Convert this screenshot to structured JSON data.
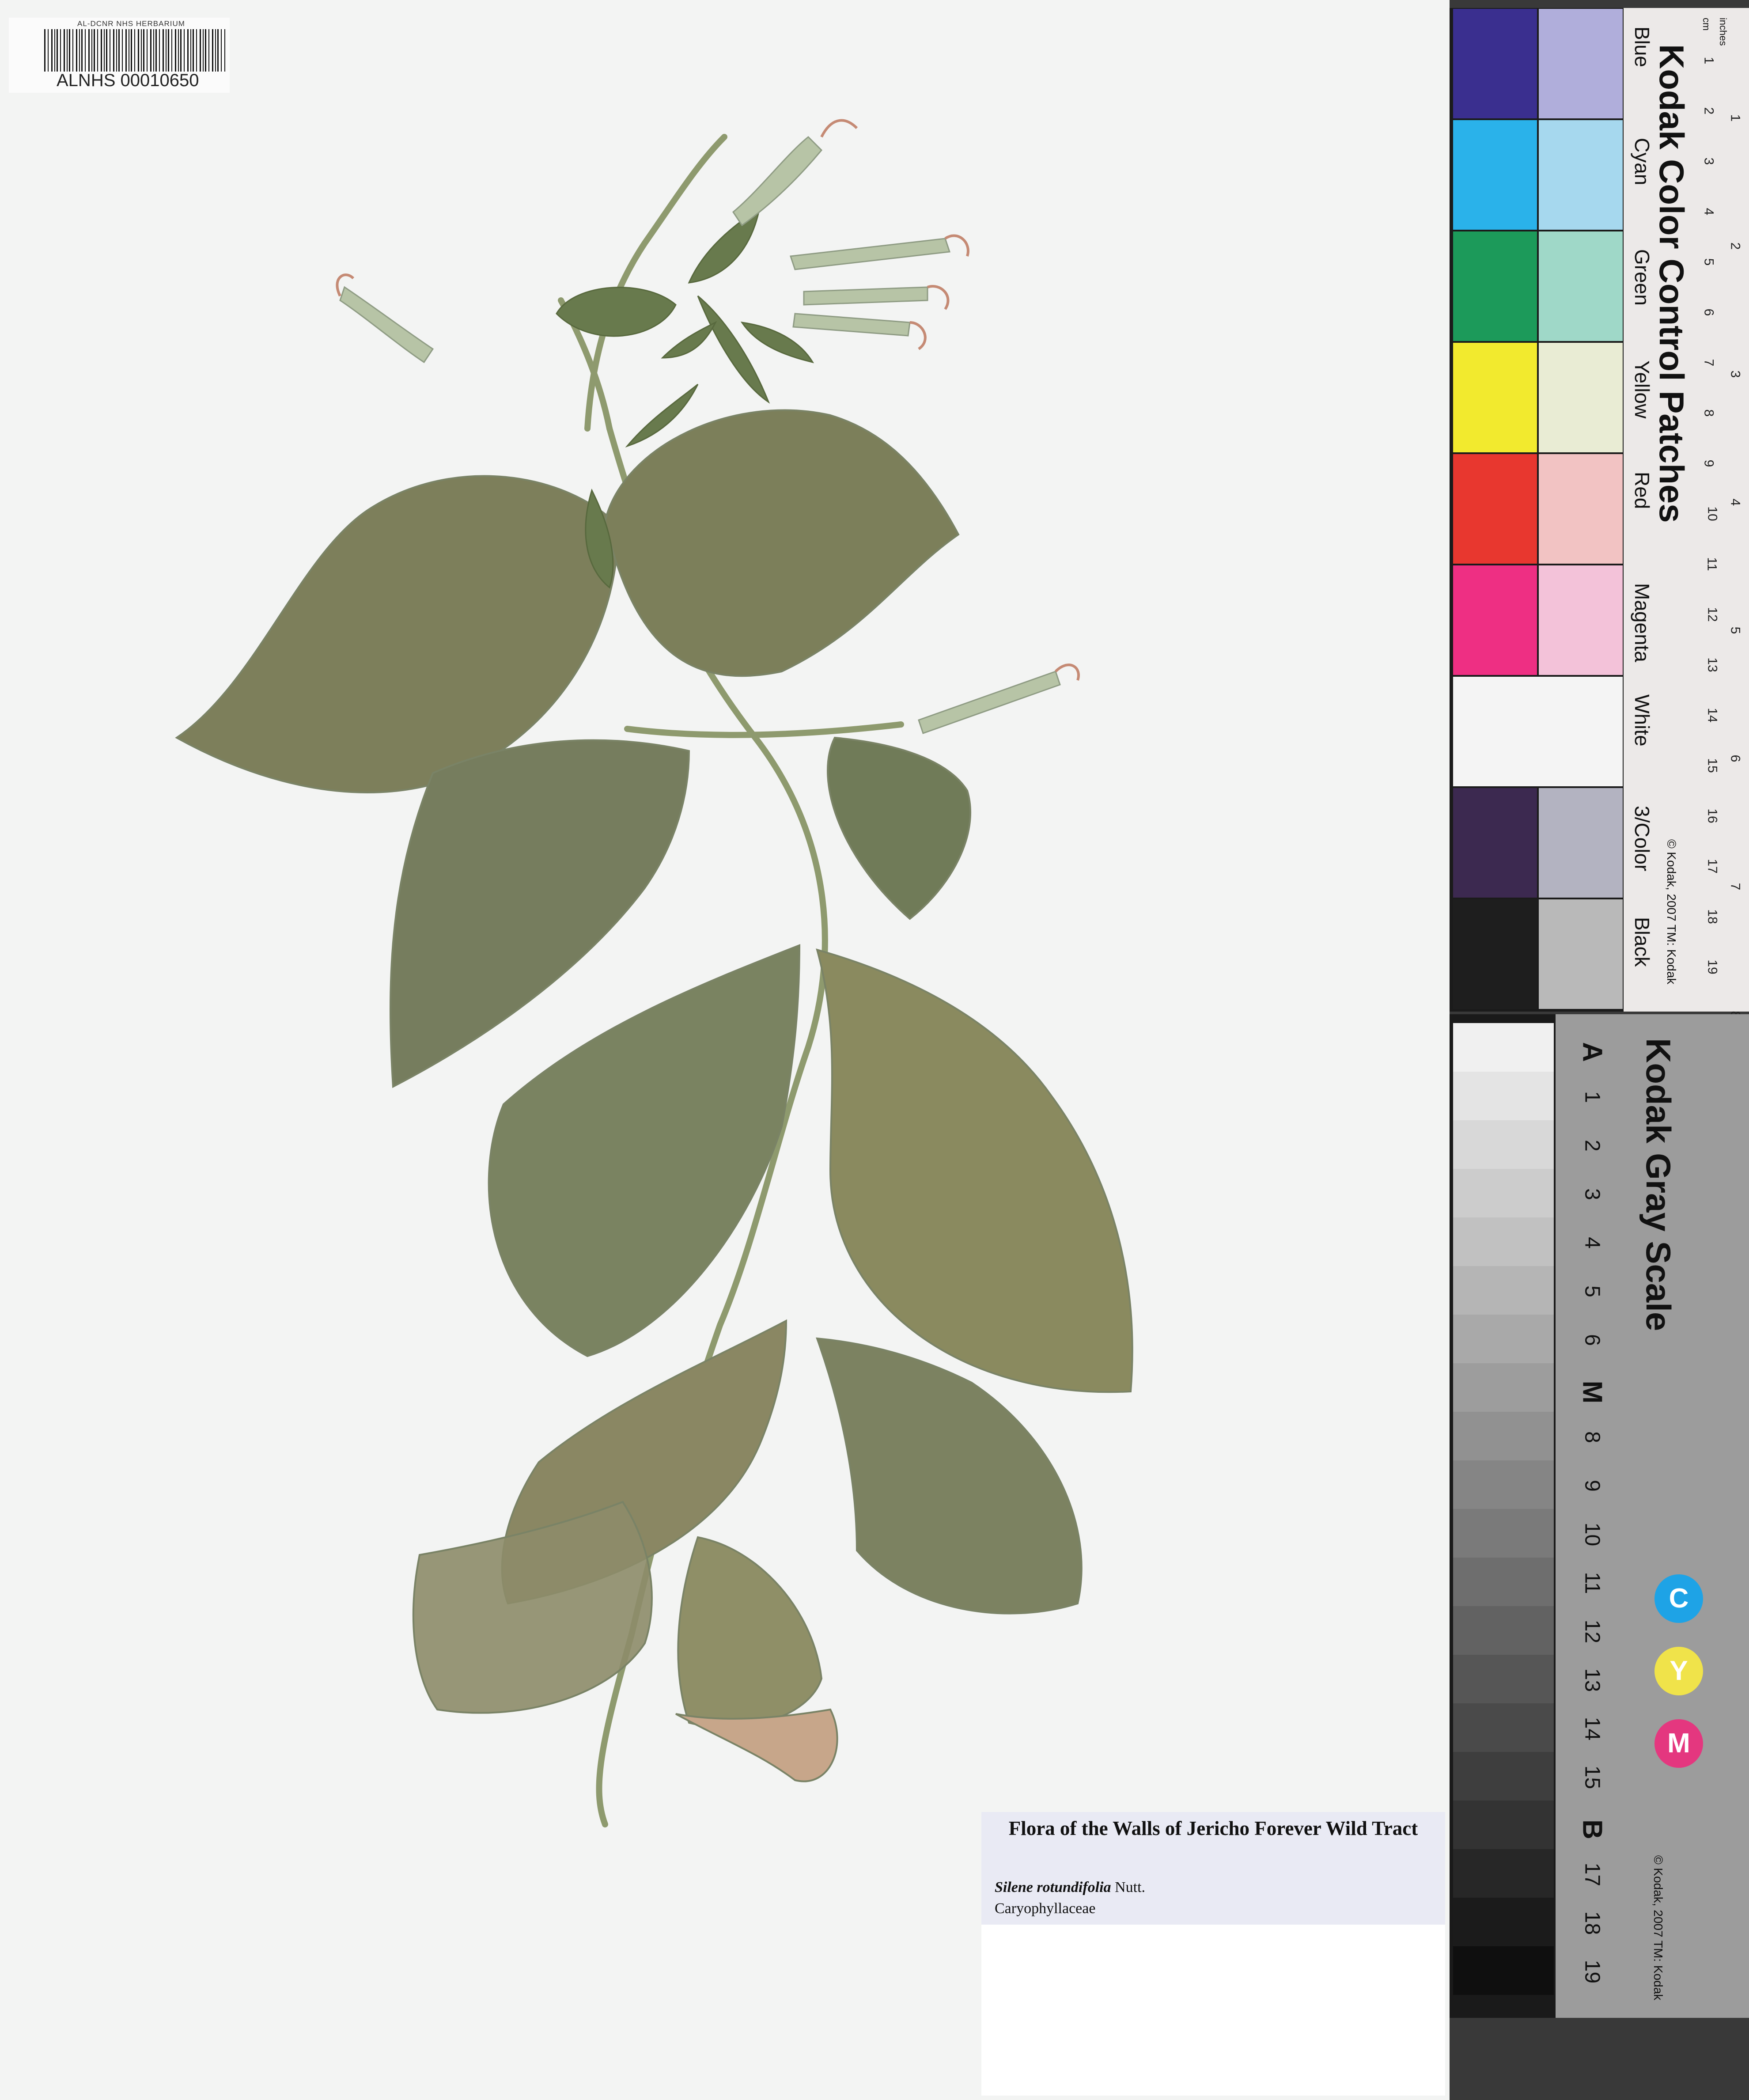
{
  "barcode": {
    "header": "AL-DCNR NHS HERBARIUM",
    "number": "ALNHS 00010650"
  },
  "label": {
    "title": "Flora of the Walls of Jericho Forever Wild Tract",
    "taxon_name": "Silene rotundifolia",
    "taxon_author": "Nutt.",
    "family": "Caryophyllaceae"
  },
  "color_card": {
    "brand": "Kodak",
    "title": "Color Control Patches",
    "patch_names": [
      "Blue",
      "Cyan",
      "Green",
      "Yellow",
      "Red",
      "Magenta",
      "White",
      "3/Color",
      "Black"
    ],
    "copyright": "© Kodak, 2007 TM: Kodak",
    "ruler_unit_cm": "cm",
    "ruler_unit_in": "inches",
    "ruler_cm": [
      "1",
      "2",
      "3",
      "4",
      "5",
      "6",
      "7",
      "8",
      "9",
      "10",
      "11",
      "12",
      "13",
      "14",
      "15",
      "16",
      "17",
      "18",
      "19"
    ],
    "ruler_in": [
      "1",
      "2",
      "3",
      "4",
      "5",
      "6",
      "7",
      "8"
    ],
    "colors": {
      "blue": "#3a2f8f",
      "blue_light": "#b0aedb",
      "cyan": "#2ab2ea",
      "cyan_light": "#a6d8ee",
      "green": "#1c9a5a",
      "green_light": "#9fd8c8",
      "yellow": "#f2ea2e",
      "yellow_light": "#e9ecd4",
      "red": "#e8372f",
      "red_light": "#f2c3c3",
      "magenta": "#ee2f83",
      "magenta_light": "#f3c2d9",
      "white": "#f4f4f4",
      "three_color": "#3c2950",
      "three_color_light": "#b3b3c1",
      "black": "#1e1e1e",
      "black_light": "#b9b9b9"
    }
  },
  "gray_scale": {
    "brand": "Kodak",
    "title": "Gray Scale",
    "steps": [
      "A",
      "1",
      "2",
      "3",
      "4",
      "5",
      "6",
      "M",
      "8",
      "9",
      "10",
      "11",
      "12",
      "13",
      "14",
      "15",
      "B",
      "17",
      "18",
      "19"
    ],
    "cmy": [
      "C",
      "Y",
      "M"
    ],
    "cmy_colors": {
      "C": "#1ea3e6",
      "Y": "#f0e34a",
      "M": "#e4377f"
    },
    "copyright": "© Kodak, 2007 TM: Kodak"
  }
}
